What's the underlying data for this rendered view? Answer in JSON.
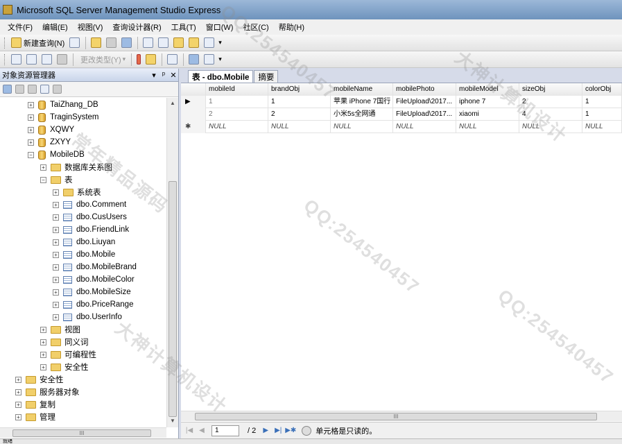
{
  "window": {
    "title": "Microsoft SQL Server Management Studio Express"
  },
  "menu": [
    "文件(F)",
    "编辑(E)",
    "视图(V)",
    "查询设计器(R)",
    "工具(T)",
    "窗口(W)",
    "社区(C)",
    "帮助(H)"
  ],
  "toolbar1": {
    "new_query_label": "新建查询(N)"
  },
  "toolbar2": {
    "change_type_label": "更改类型(Y)"
  },
  "explorer": {
    "title": "对象资源管理器",
    "pin_label": "ᵖ",
    "close_label": "✕",
    "dropdown_label": "▾",
    "tree": [
      {
        "label": "TaiZhang_DB",
        "icon": "database-icon",
        "expander": "+"
      },
      {
        "label": "TraginSystem",
        "icon": "database-icon",
        "expander": "+"
      },
      {
        "label": "XQWY",
        "icon": "database-icon",
        "expander": "+"
      },
      {
        "label": "ZXYY",
        "icon": "database-icon",
        "expander": "+"
      },
      {
        "label": "MobileDB",
        "icon": "database-icon",
        "expander": "−"
      },
      {
        "label": "数据库关系图",
        "icon": "folder-icon",
        "expander": "+"
      },
      {
        "label": "表",
        "icon": "folder-icon",
        "expander": "−"
      },
      {
        "label": "系统表",
        "icon": "folder-icon",
        "expander": "+"
      },
      {
        "label": "dbo.Comment",
        "icon": "table-icon",
        "expander": "+"
      },
      {
        "label": "dbo.CusUsers",
        "icon": "table-icon",
        "expander": "+"
      },
      {
        "label": "dbo.FriendLink",
        "icon": "table-icon",
        "expander": "+"
      },
      {
        "label": "dbo.Liuyan",
        "icon": "table-icon",
        "expander": "+"
      },
      {
        "label": "dbo.Mobile",
        "icon": "table-icon",
        "expander": "+"
      },
      {
        "label": "dbo.MobileBrand",
        "icon": "table-icon",
        "expander": "+"
      },
      {
        "label": "dbo.MobileColor",
        "icon": "table-icon",
        "expander": "+"
      },
      {
        "label": "dbo.MobileSize",
        "icon": "table-icon",
        "expander": "+"
      },
      {
        "label": "dbo.PriceRange",
        "icon": "table-icon",
        "expander": "+"
      },
      {
        "label": "dbo.UserInfo",
        "icon": "table-icon",
        "expander": "+"
      },
      {
        "label": "视图",
        "icon": "folder-icon",
        "expander": "+"
      },
      {
        "label": "同义词",
        "icon": "folder-icon",
        "expander": "+"
      },
      {
        "label": "可编程性",
        "icon": "folder-icon",
        "expander": "+"
      },
      {
        "label": "安全性",
        "icon": "folder-icon",
        "expander": "+"
      },
      {
        "label": "安全性",
        "icon": "folder-icon",
        "expander": "+"
      },
      {
        "label": "服务器对象",
        "icon": "folder-icon",
        "expander": "+"
      },
      {
        "label": "复制",
        "icon": "folder-icon",
        "expander": "+"
      },
      {
        "label": "管理",
        "icon": "folder-icon",
        "expander": "+"
      }
    ]
  },
  "tabs": [
    "表 - dbo.Mobile",
    "摘要"
  ],
  "grid": {
    "columns": [
      "mobileId",
      "brandObj",
      "mobileName",
      "mobilePhoto",
      "mobileModel",
      "sizeObj",
      "colorObj"
    ],
    "rows": [
      {
        "marker": "▶",
        "cells": [
          "1",
          "1",
          "苹果 iPhone 7国行",
          "FileUpload\\2017...",
          "iphone 7",
          "2",
          "1"
        ]
      },
      {
        "marker": "",
        "cells": [
          "2",
          "2",
          "小米5s全网通",
          "FileUpload\\2017...",
          "xiaomi",
          "4",
          "1"
        ]
      },
      {
        "marker": "✱",
        "cells": [
          "NULL",
          "NULL",
          "NULL",
          "NULL",
          "NULL",
          "NULL",
          "NULL"
        ]
      }
    ]
  },
  "pager": {
    "current": "1",
    "total": "/ 2",
    "status": "单元格是只读的。"
  },
  "scrollbar": {
    "grip": "III"
  },
  "statusbar": {
    "text": "就绪"
  },
  "watermarks": [
    "QQ:254540457",
    "大神计算机设计",
    "常年精品源码"
  ]
}
